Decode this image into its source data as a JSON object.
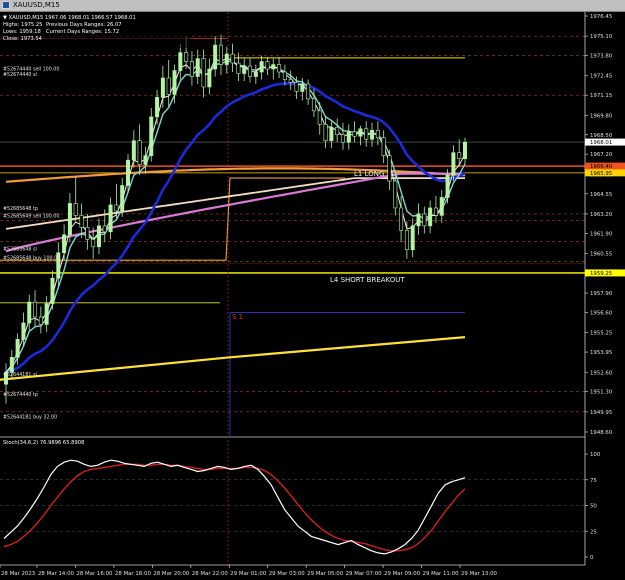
{
  "window": {
    "title": "XAUUSD,M15"
  },
  "info": {
    "line1": "▼ XAUUSD,M15  1967.06 1968.01 1966.57 1968.01",
    "line2a": "Highs: 1975.25",
    "line2b": "Previous Days Ranges: 26.07",
    "line3a": "Lows: 1959.18",
    "line3b": "Current Days Ranges: 15.72",
    "line4": "Close: 1973.54"
  },
  "price_axis": {
    "ticks": [
      "1976.45",
      "1975.10",
      "1973.80",
      "1972.45",
      "1971.15",
      "1969.80",
      "1968.50",
      "1967.20",
      "1965.85",
      "1964.55",
      "1963.20",
      "1961.90",
      "1960.55",
      "1959.25",
      "1957.90",
      "1956.60",
      "1955.25",
      "1953.95",
      "1952.60",
      "1951.30",
      "1949.95",
      "1948.60"
    ],
    "range": [
      1948.6,
      1976.45
    ],
    "current_price_tag": "1968.01",
    "tags": [
      {
        "value": 1966.4,
        "label": "1966.40",
        "color": "#f0531d"
      },
      {
        "value": 1965.95,
        "label": "1965.95",
        "color": "#ffd200"
      },
      {
        "value": 1959.25,
        "label": "1959.25",
        "color": "#ffff00"
      }
    ]
  },
  "annotations": {
    "l1": "L1 LONG",
    "l4": "L4 SHORT BREAKOUT",
    "s1": "S 1",
    "order_labels": [
      {
        "text": "#52674440 sell 100.00",
        "price": 1972.9
      },
      {
        "text": "#52674440 sl",
        "price": 1972.55
      },
      {
        "text": "#52685648 tp",
        "price": 1963.55
      },
      {
        "text": "#52685649 sell 100.00",
        "price": 1963.05
      },
      {
        "text": "#52685648 sl",
        "price": 1960.85
      },
      {
        "text": "#52685648 buy 100.00",
        "price": 1960.25
      },
      {
        "text": "#52644181 sl",
        "price": 1952.45
      },
      {
        "text": "#52674440 tp",
        "price": 1951.1
      },
      {
        "text": "#52644181 buy 32.00",
        "price": 1949.6
      }
    ]
  },
  "stoch": {
    "label": "Stoch(34,6,2) 76.9896 65.8908",
    "ticks": [
      "100",
      "75",
      "50",
      "25",
      "0"
    ],
    "main_color": "#ffffff",
    "signal_color": "#d51d1d"
  },
  "time_axis": {
    "labels": [
      "28 Mar 2023",
      "28 Mar 14:00",
      "28 Mar 16:00",
      "28 Mar 18:00",
      "28 Mar 20:00",
      "28 Mar 22:00",
      "29 Mar 01:00",
      "29 Mar 03:00",
      "29 Mar 05:00",
      "29 Mar 07:00",
      "29 Mar 09:00",
      "29 Mar 11:00",
      "29 Mar 13:00"
    ]
  },
  "colors": {
    "bull_candle": "#b6f2a4",
    "bear_candle": "#000000",
    "ma_blue": "#1b2adb",
    "ma_orange": "#f29a3c",
    "ma_pink": "#d97ad8",
    "ma_cream": "#f3dcc0",
    "ma_yellow": "#ffe135",
    "ma_cyan": "#7ed6d2",
    "ma_white": "#f0f0f0"
  },
  "chart_data": {
    "type": "candlestick",
    "symbol": "XAUUSD",
    "timeframe": "M15",
    "ylim": [
      1948.6,
      1976.45
    ],
    "candles": [
      [
        1951.8,
        1953.2,
        1950.5,
        1952.6
      ],
      [
        1952.6,
        1954.1,
        1952.2,
        1953.6
      ],
      [
        1953.6,
        1955.2,
        1953.1,
        1954.8
      ],
      [
        1954.8,
        1956.6,
        1954.4,
        1955.9
      ],
      [
        1955.9,
        1957.8,
        1955.4,
        1957.3
      ],
      [
        1957.3,
        1958.1,
        1955.7,
        1956.3
      ],
      [
        1956.3,
        1957.0,
        1955.2,
        1955.8
      ],
      [
        1955.8,
        1957.7,
        1955.3,
        1957.2
      ],
      [
        1957.2,
        1959.4,
        1956.8,
        1958.9
      ],
      [
        1958.9,
        1961.3,
        1958.4,
        1960.6
      ],
      [
        1960.6,
        1962.5,
        1960.1,
        1961.8
      ],
      [
        1961.8,
        1964.6,
        1961.3,
        1963.9
      ],
      [
        1963.9,
        1965.7,
        1962.6,
        1963.1
      ],
      [
        1963.1,
        1963.9,
        1961.6,
        1962.3
      ],
      [
        1962.3,
        1963.2,
        1960.8,
        1961.5
      ],
      [
        1961.5,
        1962.3,
        1960.2,
        1961.0
      ],
      [
        1961.0,
        1962.9,
        1960.5,
        1962.4
      ],
      [
        1962.4,
        1963.5,
        1961.3,
        1962.0
      ],
      [
        1962.0,
        1964.3,
        1961.5,
        1963.8
      ],
      [
        1963.8,
        1965.2,
        1962.9,
        1963.4
      ],
      [
        1963.4,
        1965.6,
        1963.0,
        1965.1
      ],
      [
        1965.1,
        1967.2,
        1964.6,
        1966.8
      ],
      [
        1966.8,
        1968.8,
        1966.3,
        1968.1
      ],
      [
        1968.1,
        1969.2,
        1965.8,
        1966.5
      ],
      [
        1966.5,
        1967.7,
        1965.9,
        1967.1
      ],
      [
        1967.1,
        1970.3,
        1966.7,
        1969.7
      ],
      [
        1969.7,
        1971.5,
        1969.2,
        1971.0
      ],
      [
        1971.0,
        1973.1,
        1970.3,
        1972.3
      ],
      [
        1972.3,
        1973.5,
        1970.4,
        1971.2
      ],
      [
        1971.2,
        1973.2,
        1970.6,
        1972.8
      ],
      [
        1972.8,
        1974.6,
        1972.2,
        1974.0
      ],
      [
        1974.0,
        1975.1,
        1972.9,
        1973.4
      ],
      [
        1973.4,
        1974.1,
        1971.8,
        1972.4
      ],
      [
        1972.4,
        1974.2,
        1971.9,
        1973.6
      ],
      [
        1973.6,
        1974.2,
        1971.0,
        1971.7
      ],
      [
        1971.7,
        1973.6,
        1971.2,
        1972.9
      ],
      [
        1972.9,
        1975.1,
        1972.4,
        1974.5
      ],
      [
        1974.5,
        1975.2,
        1972.5,
        1973.2
      ],
      [
        1973.2,
        1974.4,
        1972.6,
        1973.9
      ],
      [
        1973.9,
        1974.6,
        1972.7,
        1973.3
      ],
      [
        1973.3,
        1974.0,
        1972.1,
        1972.6
      ],
      [
        1972.6,
        1973.6,
        1972.1,
        1973.1
      ],
      [
        1973.1,
        1973.6,
        1972.0,
        1972.4
      ],
      [
        1972.4,
        1973.2,
        1971.9,
        1972.7
      ],
      [
        1972.7,
        1973.8,
        1972.2,
        1973.4
      ],
      [
        1973.4,
        1973.7,
        1972.5,
        1972.9
      ],
      [
        1972.9,
        1973.6,
        1972.2,
        1973.2
      ],
      [
        1973.2,
        1973.7,
        1972.3,
        1972.7
      ],
      [
        1972.7,
        1973.2,
        1971.8,
        1972.2
      ],
      [
        1972.2,
        1972.8,
        1971.5,
        1972.0
      ],
      [
        1972.0,
        1972.4,
        1970.9,
        1971.4
      ],
      [
        1971.4,
        1972.3,
        1970.8,
        1971.9
      ],
      [
        1971.9,
        1972.2,
        1970.5,
        1970.9
      ],
      [
        1970.9,
        1971.6,
        1969.7,
        1970.1
      ],
      [
        1970.1,
        1970.7,
        1968.5,
        1969.2
      ],
      [
        1969.2,
        1969.7,
        1967.6,
        1968.1
      ],
      [
        1968.1,
        1969.4,
        1967.6,
        1969.0
      ],
      [
        1969.0,
        1969.6,
        1968.0,
        1968.5
      ],
      [
        1968.5,
        1969.3,
        1967.5,
        1968.0
      ],
      [
        1968.0,
        1969.2,
        1967.5,
        1968.7
      ],
      [
        1968.7,
        1969.4,
        1968.0,
        1968.4
      ],
      [
        1968.4,
        1969.1,
        1967.8,
        1968.9
      ],
      [
        1968.9,
        1969.4,
        1967.7,
        1968.2
      ],
      [
        1968.2,
        1969.3,
        1967.7,
        1968.8
      ],
      [
        1968.8,
        1969.4,
        1967.8,
        1968.3
      ],
      [
        1968.3,
        1968.8,
        1966.6,
        1967.1
      ],
      [
        1967.1,
        1967.5,
        1964.8,
        1965.4
      ],
      [
        1965.4,
        1965.8,
        1963.1,
        1963.6
      ],
      [
        1963.6,
        1964.4,
        1961.3,
        1962.1
      ],
      [
        1962.1,
        1962.7,
        1960.2,
        1960.8
      ],
      [
        1960.8,
        1962.9,
        1960.3,
        1962.4
      ],
      [
        1962.4,
        1963.9,
        1961.8,
        1963.2
      ],
      [
        1963.2,
        1963.7,
        1961.9,
        1962.4
      ],
      [
        1962.4,
        1964.1,
        1961.9,
        1963.6
      ],
      [
        1963.6,
        1964.4,
        1962.6,
        1963.1
      ],
      [
        1963.1,
        1964.8,
        1962.6,
        1964.3
      ],
      [
        1964.3,
        1966.2,
        1963.9,
        1965.8
      ],
      [
        1965.8,
        1967.8,
        1965.4,
        1967.3
      ],
      [
        1967.3,
        1968.2,
        1966.4,
        1966.9
      ],
      [
        1966.9,
        1968.3,
        1966.5,
        1968.0
      ]
    ],
    "stoch": {
      "main": [
        18,
        24,
        30,
        38,
        47,
        57,
        68,
        80,
        88,
        92,
        94,
        93,
        90,
        88,
        89,
        92,
        94,
        93,
        91,
        90,
        89,
        88,
        91,
        92,
        90,
        88,
        89,
        87,
        85,
        83,
        84,
        86,
        88,
        87,
        85,
        86,
        88,
        89,
        85,
        78,
        70,
        58,
        46,
        38,
        30,
        25,
        20,
        18,
        16,
        14,
        12,
        14,
        16,
        12,
        9,
        6,
        4,
        3,
        5,
        8,
        12,
        18,
        26,
        38,
        50,
        62,
        70,
        73,
        75,
        77
      ],
      "signal": [
        10,
        12,
        15,
        20,
        26,
        33,
        41,
        50,
        58,
        66,
        73,
        79,
        83,
        85,
        86,
        87,
        88,
        89,
        90,
        90,
        90,
        89,
        89,
        90,
        90,
        89,
        89,
        88,
        87,
        86,
        85,
        85,
        86,
        86,
        86,
        86,
        87,
        87,
        86,
        84,
        80,
        74,
        67,
        59,
        51,
        43,
        36,
        30,
        25,
        21,
        18,
        16,
        15,
        14,
        13,
        11,
        9,
        7,
        6,
        6,
        7,
        9,
        13,
        19,
        26,
        35,
        44,
        52,
        60,
        66
      ]
    }
  }
}
